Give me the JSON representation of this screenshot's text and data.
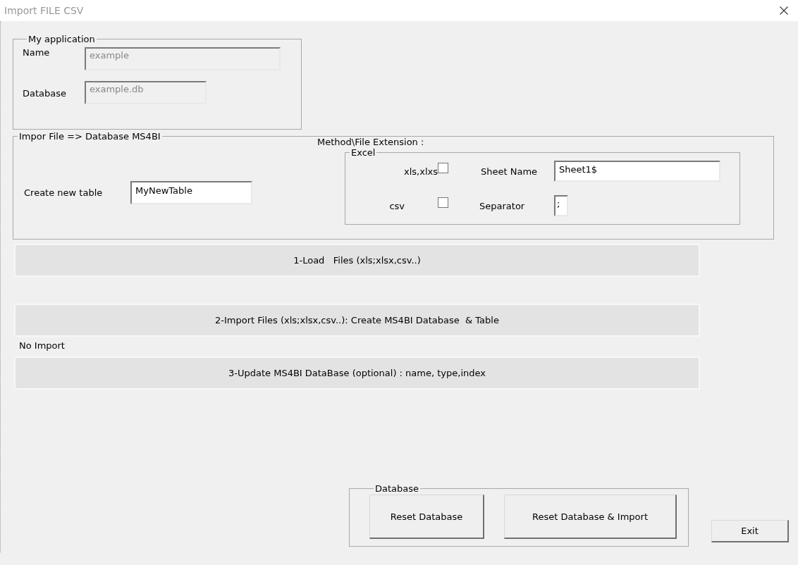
{
  "window": {
    "title": "Import FILE CSV"
  },
  "my_application": {
    "legend": "My application",
    "fields": [
      {
        "label": "Name",
        "value": "example",
        "disabled": true
      },
      {
        "label": "Database",
        "value": "example.db",
        "disabled": true
      }
    ]
  },
  "import_section": {
    "legend": "Impor File => Database MS4BI",
    "new_table": {
      "label": "Create new table",
      "value": "MyNewTable",
      "disabled": false
    },
    "method_label": "Method\\File Extension :",
    "excel": {
      "legend": "Excel",
      "rows": [
        {
          "label": "xls,xlxs",
          "checked": false,
          "field_label": "Sheet Name",
          "value": "Sheet1$"
        },
        {
          "label": "csv",
          "checked": false,
          "field_label": "Separator",
          "value": ";"
        }
      ]
    }
  },
  "actions": [
    {
      "kind": "button",
      "text": "1-Load   Files (xls;xlsx,csv..)"
    },
    {
      "kind": "button",
      "text": "2-Import Files (xls;xlsx,csv..): Create MS4BI Database  & Table"
    },
    {
      "kind": "status",
      "text": "No Import"
    },
    {
      "kind": "button",
      "text": "3-Update MS4BI DataBase (optional) : name, type,index"
    }
  ],
  "database_group": {
    "legend": "Database",
    "buttons": [
      "Reset Database",
      "Reset Database & Import"
    ]
  },
  "exit_button": "Exit"
}
